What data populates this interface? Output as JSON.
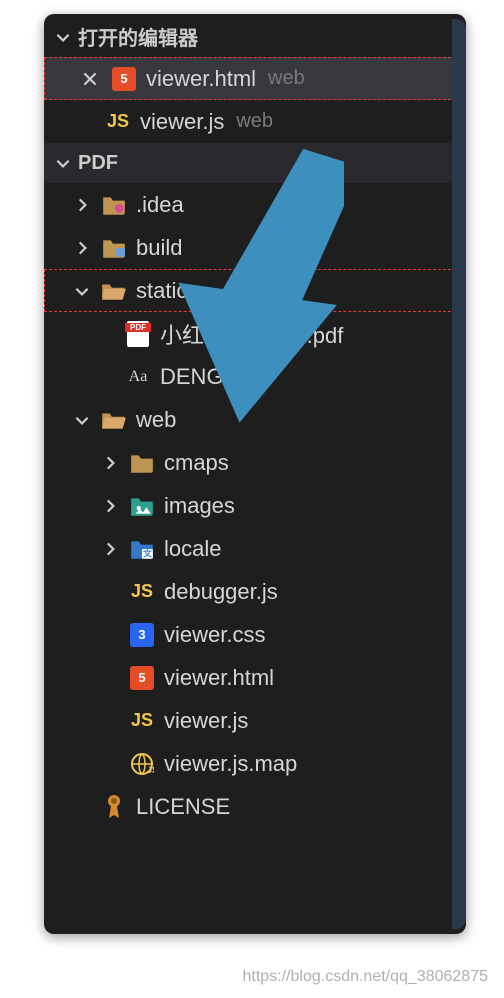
{
  "sections": {
    "open_editors_title": "打开的编辑器",
    "project_title": "PDF"
  },
  "open_editors": [
    {
      "name": "viewer.html",
      "dir": "web",
      "icon": "html5",
      "active": true,
      "highlighted": true
    },
    {
      "name": "viewer.js",
      "dir": "web",
      "icon": "js",
      "active": false,
      "highlighted": false
    }
  ],
  "tree": {
    "idea": ".idea",
    "build": "build",
    "static": "static",
    "static_pdf": "小红书(第四版).pdf",
    "static_ttf": "DENG.TTF",
    "web": "web",
    "cmaps": "cmaps",
    "images": "images",
    "locale": "locale",
    "debugger": "debugger.js",
    "viewer_css": "viewer.css",
    "viewer_html": "viewer.html",
    "viewer_js": "viewer.js",
    "viewer_map": "viewer.js.map",
    "license": "LICENSE"
  },
  "watermark": "https://blog.csdn.net/qq_38062875"
}
